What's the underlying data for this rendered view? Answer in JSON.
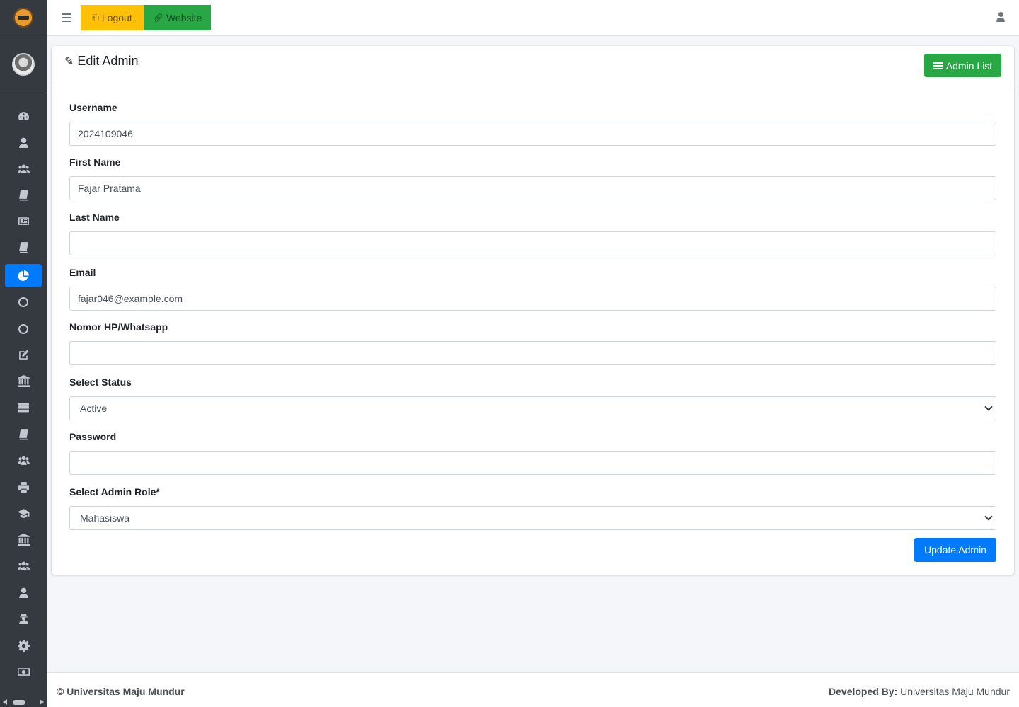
{
  "topbar": {
    "logout_label": "Logout",
    "website_label": "Website"
  },
  "card": {
    "title": "Edit Admin",
    "admin_list_label": "Admin List"
  },
  "form": {
    "username": {
      "label": "Username",
      "value": "2024109046"
    },
    "first_name": {
      "label": "First Name",
      "value": "Fajar Pratama"
    },
    "last_name": {
      "label": "Last Name",
      "value": ""
    },
    "email": {
      "label": "Email",
      "value": "fajar046@example.com"
    },
    "phone": {
      "label": "Nomor HP/Whatsapp",
      "value": ""
    },
    "status": {
      "label": "Select Status",
      "value": "Active"
    },
    "password": {
      "label": "Password",
      "value": ""
    },
    "role": {
      "label": "Select Admin Role*",
      "value": "Mahasiswa"
    },
    "submit_label": "Update Admin"
  },
  "footer": {
    "copyright": "© Universitas Maju Mundur",
    "developed_by_label": "Developed By:",
    "developed_by_value": "Universitas Maju Mundur"
  },
  "sidebar": {
    "icons": [
      "dashboard-icon",
      "user-icon",
      "users-icon",
      "book-icon",
      "newspaper-icon",
      "book-icon",
      "pie-chart-icon",
      "circle-icon",
      "circle-icon",
      "edit-icon",
      "institution-icon",
      "server-icon",
      "book-icon",
      "users-icon",
      "print-icon",
      "graduation-cap-icon",
      "institution-icon",
      "users-icon",
      "user-icon",
      "user-secret-icon",
      "gear-icon",
      "money-icon"
    ],
    "active_icon": "pie-chart-icon"
  },
  "colors": {
    "sidebar_bg": "#343a40",
    "primary": "#007bff",
    "success": "#28a745",
    "warning": "#ffc107"
  }
}
